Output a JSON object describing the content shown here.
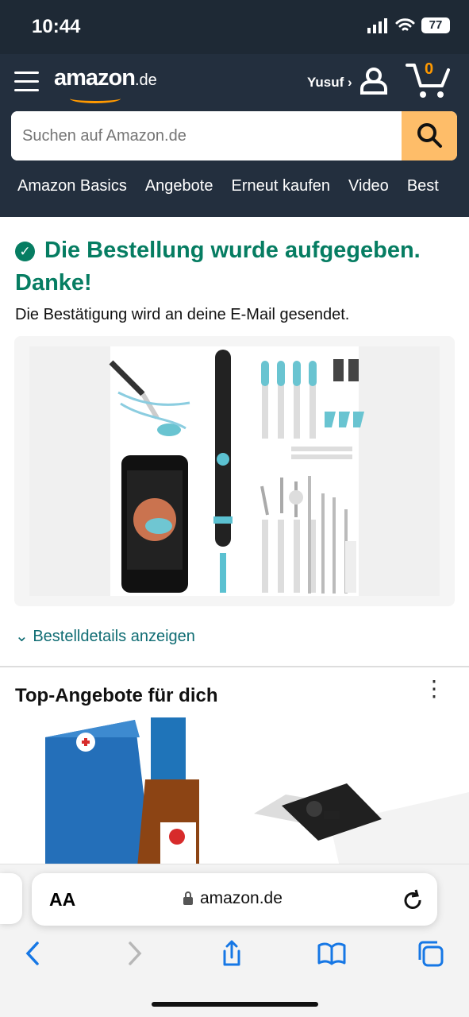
{
  "status": {
    "time": "10:44",
    "battery": "77"
  },
  "header": {
    "logo": "amazon",
    "logo_domain": ".de",
    "account": "Yusuf ›",
    "cart_count": "0",
    "search_placeholder": "Suchen auf Amazon.de",
    "nav_items": [
      "Amazon Basics",
      "Angebote",
      "Erneut kaufen",
      "Video",
      "Best"
    ]
  },
  "order": {
    "confirmation": "Die Bestellung wurde aufgegeben. Danke!",
    "email_note": "Die Bestätigung wird an deine E-Mail gesendet.",
    "details_link": "Bestelldetails anzeigen"
  },
  "recommendations": {
    "title": "Top-Angebote für dich"
  },
  "browser": {
    "text_size": "AA",
    "url": "amazon.de"
  },
  "colors": {
    "header": "#232f3e",
    "accent": "#ff9900",
    "search_button": "#febd69",
    "success": "#067d62",
    "link": "#0f6c73"
  },
  "icons": [
    "menu-icon",
    "user-icon",
    "cart-icon",
    "search-icon",
    "check-icon",
    "chevron-down-icon",
    "more-icon",
    "lock-icon",
    "reload-icon",
    "back-icon",
    "forward-icon",
    "share-icon",
    "bookmarks-icon",
    "tabs-icon"
  ]
}
